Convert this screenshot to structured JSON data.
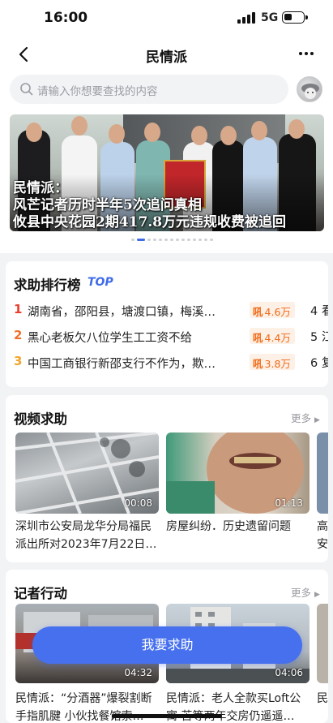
{
  "status": {
    "time": "16:00",
    "network": "5G"
  },
  "nav": {
    "title": "民情派"
  },
  "search": {
    "placeholder": "请输入你想要查找的内容"
  },
  "banner": {
    "line1": "民情派：",
    "line2": "风芒记者历时半年5次追问真相",
    "line3": "攸县中央花园2期417.8万元违规收费被追回",
    "slide_count": 14,
    "active_slide": 1
  },
  "ranking": {
    "title": "求助排行榜",
    "badge": "TOP",
    "items": [
      {
        "rank": "1",
        "text": "湖南省，邵阳县，塘渡口镇，梅溪…",
        "heat_label": "吼",
        "heat": "4.6万",
        "next": "4 看"
      },
      {
        "rank": "2",
        "text": "黑心老板欠八位学生工工资不给",
        "heat_label": "吼",
        "heat": "4.4万",
        "next": "5 江"
      },
      {
        "rank": "3",
        "text": "中国工商银行新邵支行不作为，欺…",
        "heat_label": "吼",
        "heat": "3.8万",
        "next": "6 复"
      }
    ],
    "rank_colors": [
      "#e8402e",
      "#f0702a",
      "#f2a62a"
    ]
  },
  "video_help": {
    "title": "视频求助",
    "more": "更多",
    "items": [
      {
        "title": "深圳市公安局龙华分局福民派出所对2023年7月22日…",
        "duration": "00:08"
      },
      {
        "title": "房屋纠纷．历史遗留问题",
        "duration": "01:13"
      },
      {
        "title": "高\n安",
        "duration": ""
      }
    ]
  },
  "reporter": {
    "title": "记者行动",
    "more": "更多",
    "items": [
      {
        "title": "民情派：“分酒器”爆裂割断手指肌腱 小伙找餐馆索…",
        "duration": "04:32"
      },
      {
        "title": "民情派：老人全款买Loft公寓 苦等两年交房仍遥遥…",
        "duration": "04:06"
      },
      {
        "title": "民",
        "duration": ""
      }
    ]
  },
  "cta": {
    "label": "我要求助"
  }
}
